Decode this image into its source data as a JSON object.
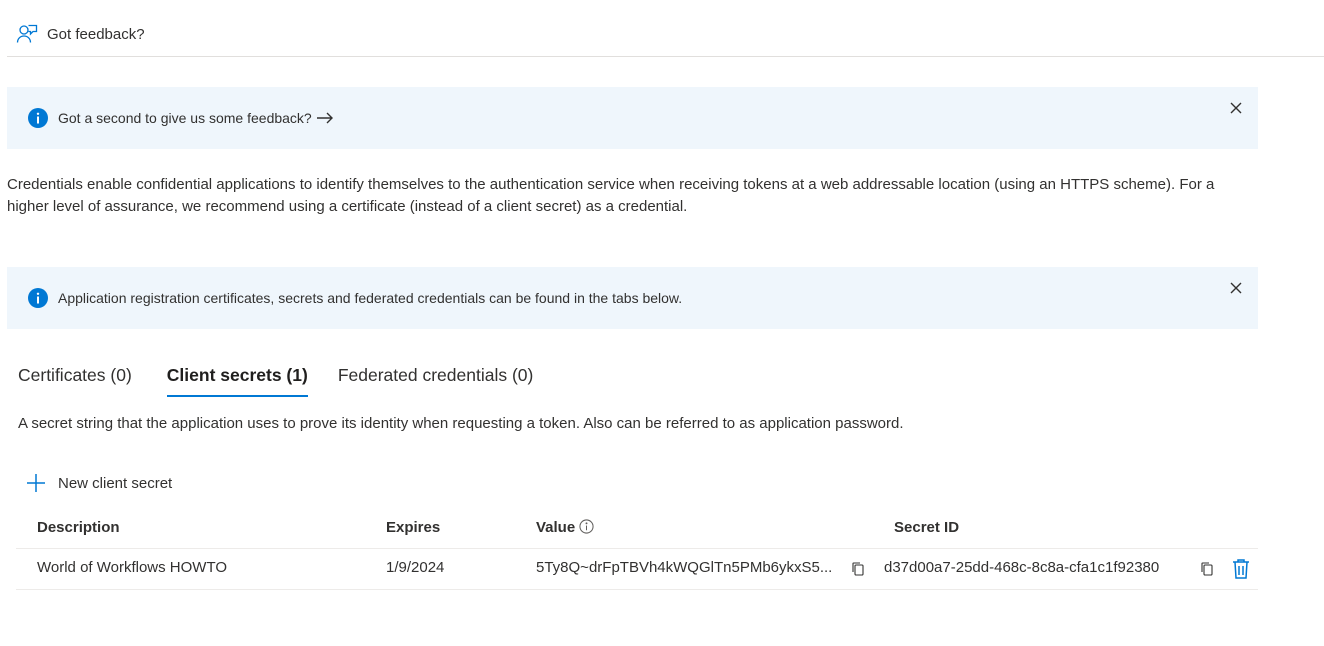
{
  "toolbar": {
    "feedback_label": "Got feedback?"
  },
  "banners": [
    {
      "message": "Got a second to give us some feedback?"
    },
    {
      "message": "Application registration certificates, secrets and federated credentials can be found in the tabs below."
    }
  ],
  "description": "Credentials enable confidential applications to identify themselves to the authentication service when receiving tokens at a web addressable location (using an HTTPS scheme). For a higher level of assurance, we recommend using a certificate (instead of a client secret) as a credential.",
  "tabs": [
    {
      "label": "Certificates (0)",
      "selected": false
    },
    {
      "label": "Client secrets (1)",
      "selected": true
    },
    {
      "label": "Federated credentials (0)",
      "selected": false
    }
  ],
  "secrets_description": "A secret string that the application uses to prove its identity when requesting a token. Also can be referred to as application password.",
  "new_secret_label": "New client secret",
  "table": {
    "columns": [
      "Description",
      "Expires",
      "Value",
      "Secret ID"
    ],
    "rows": [
      {
        "description": "World of Workflows HOWTO",
        "expires": "1/9/2024",
        "value": "5Ty8Q~drFpTBVh4kWQGlTn5PMb6ykxS5...",
        "secret_id": "d37d00a7-25dd-468c-8c8a-cfa1c1f92380"
      }
    ]
  },
  "colors": {
    "accent": "#0078d4",
    "banner_bg": "#eff6fc",
    "text": "#323130"
  },
  "icons": [
    "feedback-icon",
    "info-icon",
    "close-icon",
    "arrow-right-icon",
    "plus-icon",
    "copy-icon",
    "delete-icon"
  ]
}
